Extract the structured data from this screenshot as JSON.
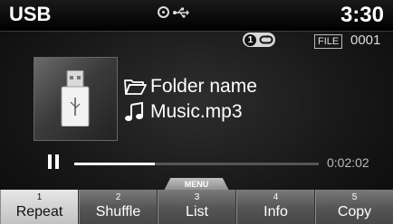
{
  "status": {
    "source": "USB",
    "time": "3:30",
    "icons": [
      "disc-ring-icon",
      "usb-icon"
    ]
  },
  "info": {
    "repeat_badge_number": "1",
    "file_label": "FILE",
    "file_number": "0001"
  },
  "track": {
    "folder_name": "Folder name",
    "file_name": "Music.mp3"
  },
  "playback": {
    "state": "paused",
    "elapsed": "0:02:02",
    "progress_fraction": 0.33
  },
  "menu": {
    "tab_label": "MENU",
    "softkeys": [
      {
        "number": "1",
        "label": "Repeat",
        "active": true
      },
      {
        "number": "2",
        "label": "Shuffle",
        "active": false
      },
      {
        "number": "3",
        "label": "List",
        "active": false
      },
      {
        "number": "4",
        "label": "Info",
        "active": false
      },
      {
        "number": "5",
        "label": "Copy",
        "active": false
      }
    ]
  },
  "colors": {
    "background": "#1c1c1c",
    "softkey_active": "#d8d8d8",
    "softkey_inactive": "#5e5e5e"
  }
}
